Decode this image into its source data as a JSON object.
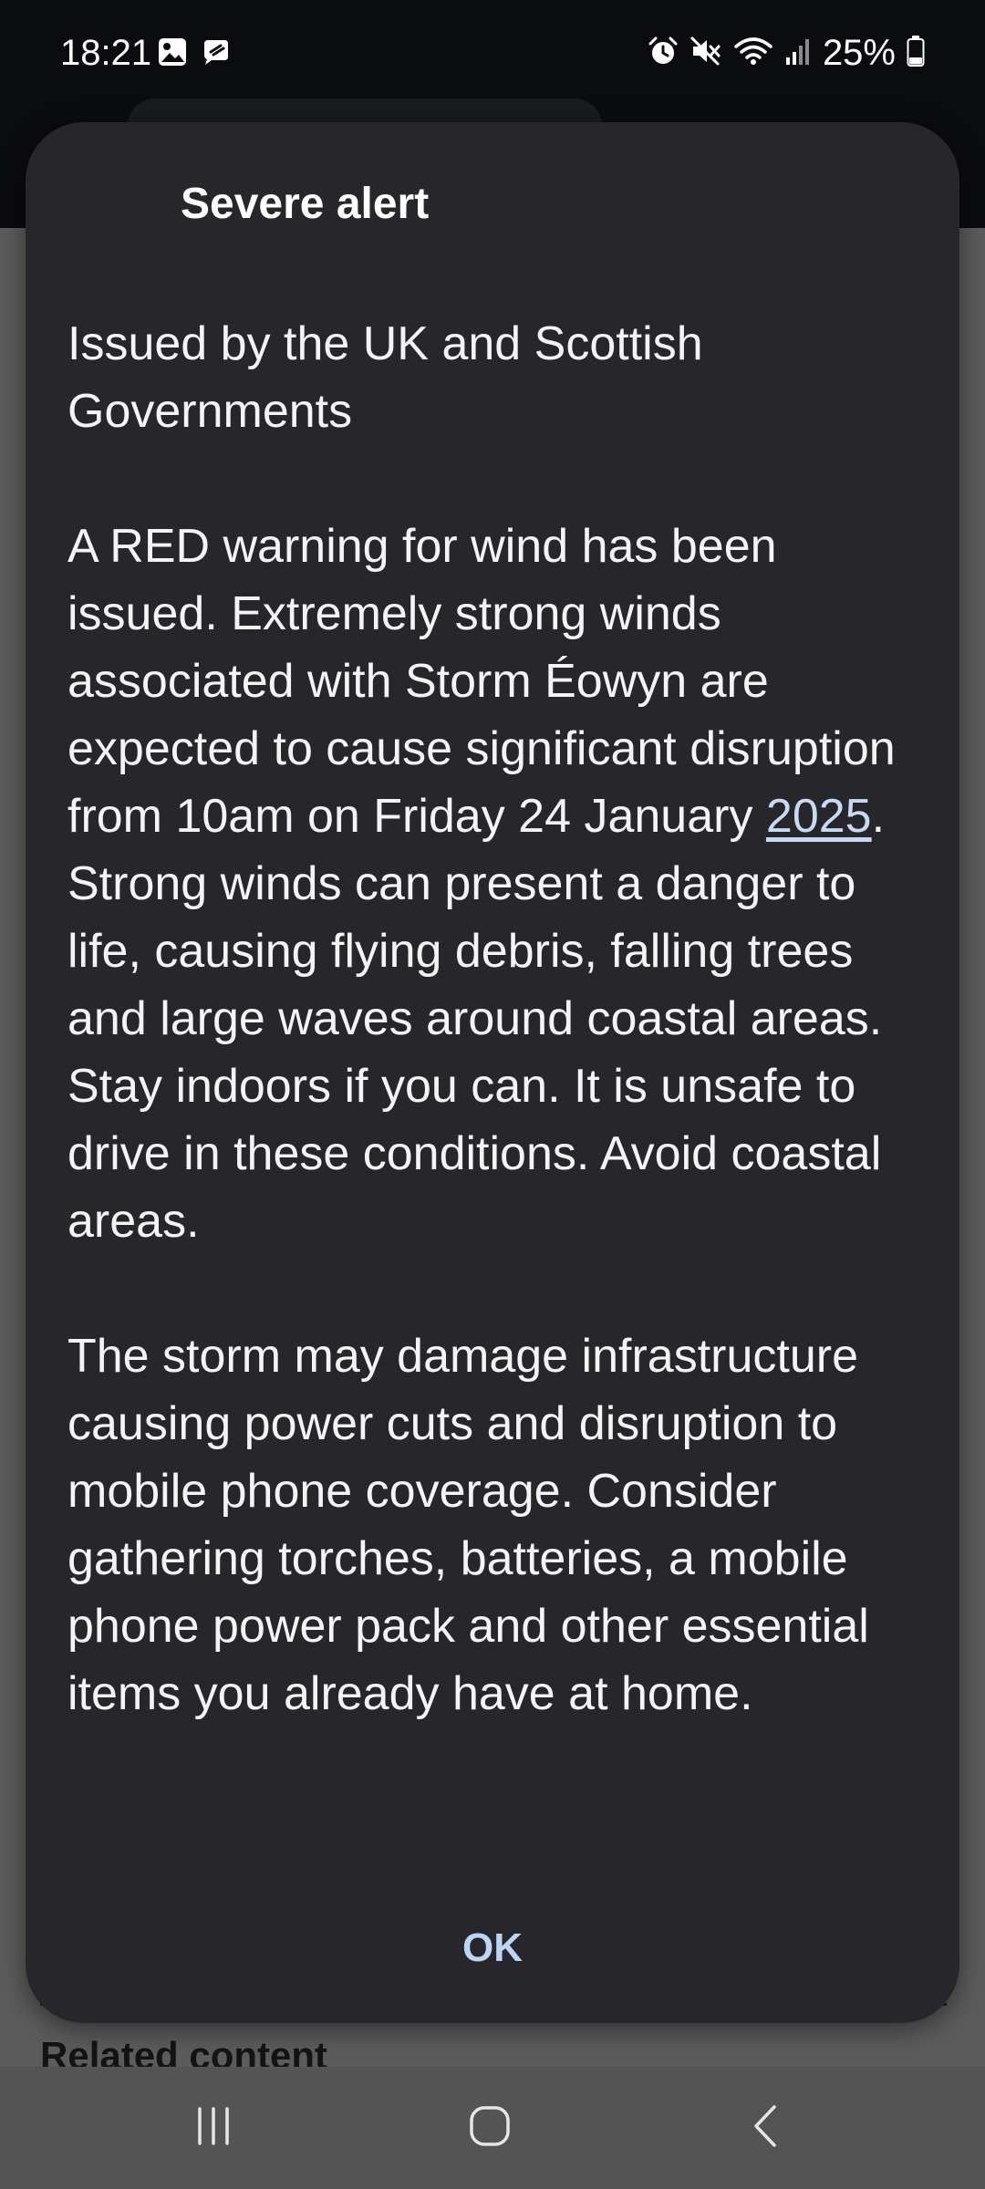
{
  "status_bar": {
    "time": "18:21",
    "battery_percent": "25%",
    "left_icons": [
      "gallery-icon",
      "notification-app-icon"
    ],
    "right_icons": [
      "alarm-icon",
      "mute-icon",
      "wifi-icon",
      "signal-icon",
      "battery-icon"
    ]
  },
  "background": {
    "related_content": "Related content"
  },
  "dialog": {
    "title": "Severe alert",
    "issuer": "Issued by the UK and Scottish Governments",
    "warning_before_link": "A RED warning for wind has been issued. Extremely strong winds associated with Storm Éowyn are expected to cause significant disruption from 10am on Friday 24 January ",
    "warning_link": "2025",
    "warning_after_link": ". Strong winds can present a danger to life, causing flying debris, falling trees and large waves around coastal areas. Stay indoors if you can. It is unsafe to drive in these conditions. Avoid coastal areas.",
    "advice": "The storm may damage infrastructure causing power cuts and disruption to mobile phone coverage. Consider gathering torches, batteries, a mobile phone power pack and other essential items you already have at home.",
    "ok_label": "OK"
  },
  "nav_bar": {
    "icons": [
      "recent-apps-icon",
      "home-icon",
      "back-icon"
    ]
  },
  "colors": {
    "dialog_bg": "#27272b",
    "link": "#c9d9f4",
    "ok": "#bcd4f5"
  }
}
